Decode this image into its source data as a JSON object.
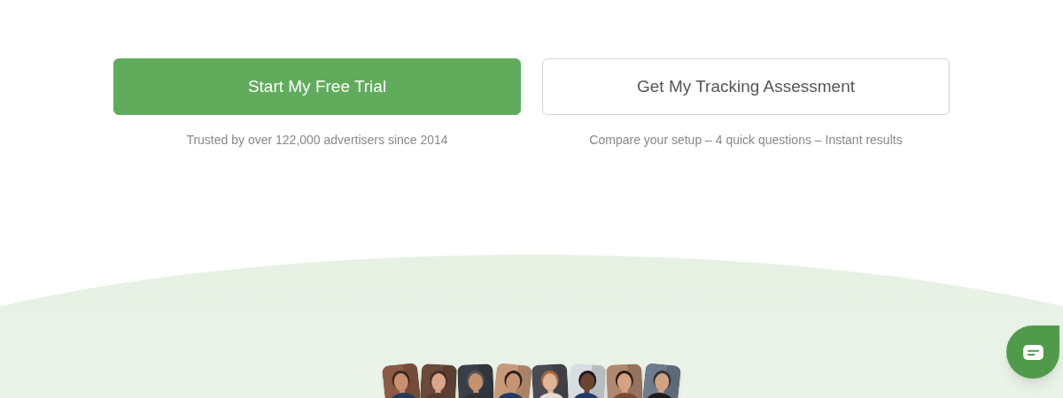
{
  "actions": [
    {
      "kind": "primary",
      "label": "Start My Free Trial",
      "caption": "Trusted by over 122,000 advertisers since 2014"
    },
    {
      "kind": "secondary",
      "label": "Get My Tracking Assessment",
      "caption": "Compare your setup – 4 quick questions – Instant results"
    }
  ]
}
